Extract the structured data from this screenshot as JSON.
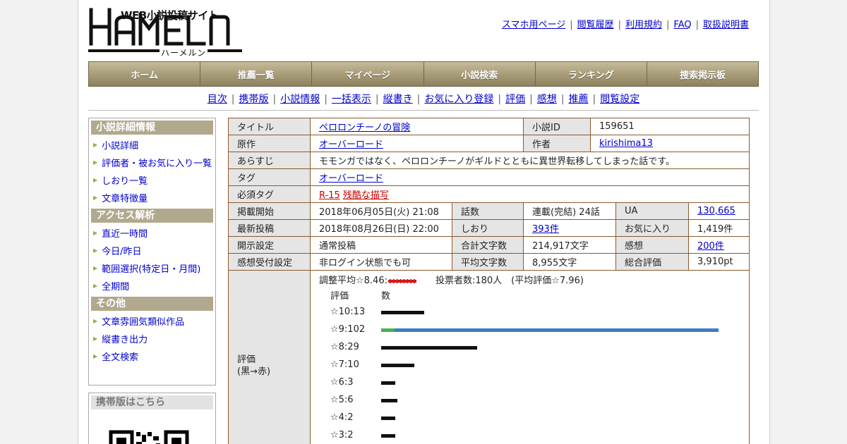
{
  "site": {
    "logo_text": "HAMELN",
    "logo_tagline": "WEB小説投稿サイト",
    "logo_kana": "ハーメルン"
  },
  "top_links": [
    "スマホ用ページ",
    "閲覧履歴",
    "利用規約",
    "FAQ",
    "取扱説明書"
  ],
  "main_nav": [
    "ホーム",
    "推薦一覧",
    "マイページ",
    "小説検索",
    "ランキング",
    "捜索掲示板"
  ],
  "sub_nav": [
    "目次",
    "携帯版",
    "小説情報",
    "一括表示",
    "縦書き",
    "お気に入り登録",
    "評価",
    "感想",
    "推薦",
    "閲覧設定"
  ],
  "sidebar": {
    "sections": [
      {
        "title": "小説詳細情報",
        "items": [
          "小説詳細",
          "評価者・被お気に入り一覧",
          "しおり一覧",
          "文章特徴量"
        ]
      },
      {
        "title": "アクセス解析",
        "items": [
          "直近一時間",
          "今日/昨日",
          "範囲選択(特定日・月間)",
          "全期間"
        ]
      },
      {
        "title": "その他",
        "items": [
          "文章雰囲気類似作品",
          "縦書き出力",
          "全文検索"
        ]
      }
    ],
    "mobile_title": "携帯版はこちら"
  },
  "info": {
    "title_label": "タイトル",
    "title": "ペロロンチーノの冒険",
    "novel_id_label": "小説ID",
    "novel_id": "159651",
    "original_label": "原作",
    "original": "オーバーロード",
    "author_label": "作者",
    "author": "kirishima13",
    "synopsis_label": "あらすじ",
    "synopsis": "モモンガではなく、ペロロンチーノがギルドとともに異世界転移してしまった話です。",
    "tags_label": "タグ",
    "tag": "オーバーロード",
    "required_tags_label": "必須タグ",
    "required_tag_1": "R-15",
    "required_tag_2": "残酷な描写",
    "start_label": "掲載開始",
    "start": "2018年06月05日(火) 21:08",
    "episodes_label": "話数",
    "episodes": "連載(完結) 24話",
    "ua_label": "UA",
    "ua": "130,665",
    "latest_label": "最新投稿",
    "latest": "2018年08月26日(日) 22:00",
    "bookmark_label": "しおり",
    "bookmark": "393件",
    "favorites_label": "お気に入り",
    "favorites": "1,419件",
    "public_label": "開示設定",
    "public": "通常投稿",
    "total_chars_label": "合計文字数",
    "total_chars": "214,917文字",
    "reviews_label": "感想",
    "reviews": "200件",
    "review_accept_label": "感想受付設定",
    "review_accept": "非ログイン状態でも可",
    "avg_chars_label": "平均文字数",
    "avg_chars": "8,955文字",
    "overall_label": "総合評価",
    "overall": "3,910pt",
    "rating_label_1": "評価",
    "rating_label_2": "(黒→赤)",
    "adjusted_avg": "調整平均☆8.46:",
    "voters": "投票者数:180人　(平均評価☆7.96)",
    "hist_col_rating": "評価",
    "hist_col_count": "数"
  },
  "chart_data": {
    "type": "bar",
    "categories": [
      "☆10",
      "☆9",
      "☆8",
      "☆7",
      "☆6",
      "☆5",
      "☆4",
      "☆3"
    ],
    "values": [
      13,
      102,
      29,
      10,
      3,
      5,
      2,
      2
    ],
    "labels": [
      "☆10:13",
      "☆9:102",
      "☆8:29",
      "☆7:10",
      "☆6:3",
      "☆5:6",
      "☆4:2",
      "☆3:2"
    ],
    "xlabel": "評価",
    "ylabel": "数"
  },
  "colors": {
    "nav_gradient_top": "#c6bb9b",
    "nav_gradient_bottom": "#8d815e",
    "table_border": "#8b5a2b",
    "link": "#0000cc",
    "adjusted_bar": "#d81818",
    "bar_9_green": "#4caf50",
    "bar_9_blue": "#3a7fc1"
  }
}
